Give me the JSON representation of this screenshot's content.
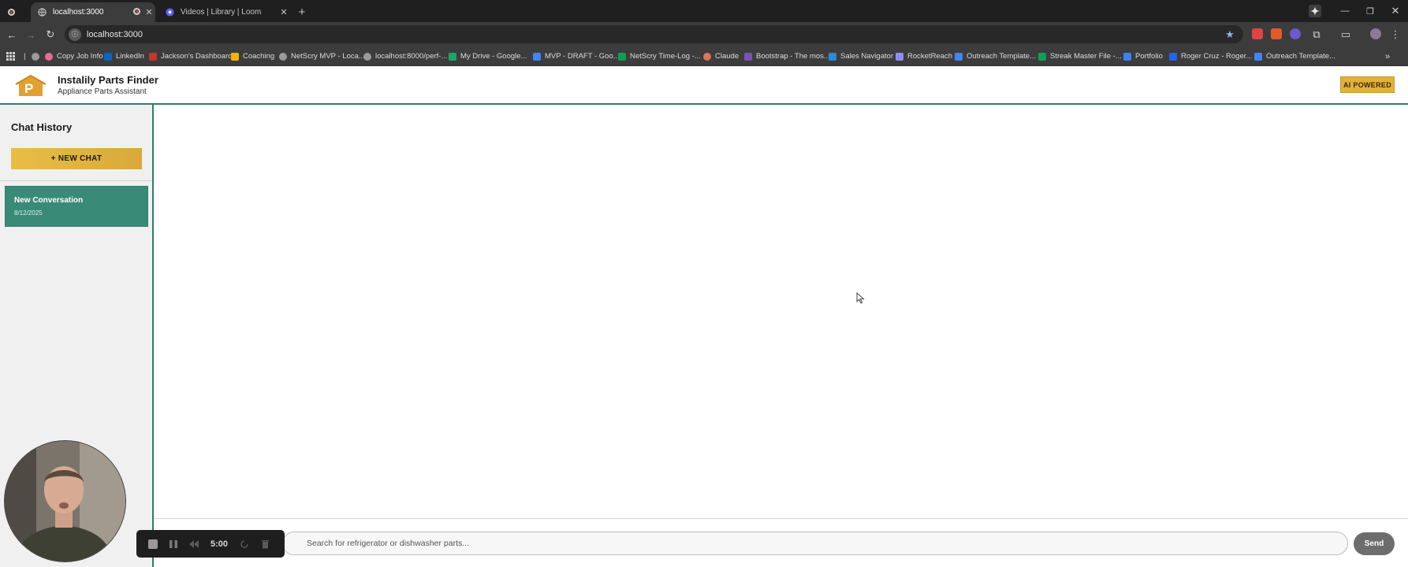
{
  "browser": {
    "tabs": [
      {
        "title": "localhost:3000",
        "active": true
      },
      {
        "title": "Videos | Library | Loom",
        "active": false
      }
    ],
    "new_tab_label": "+",
    "url": "localhost:3000",
    "bookmarks": [
      {
        "label": "Copy Job Info",
        "icon": "pink-dot-icon"
      },
      {
        "label": "LinkedIn",
        "icon": "linkedin-icon"
      },
      {
        "label": "Jackson's Dashboard",
        "icon": "dashboard-icon"
      },
      {
        "label": "Coaching",
        "icon": "drive-icon"
      },
      {
        "label": "NetScry MVP - Loca...",
        "icon": "globe-icon"
      },
      {
        "label": "localhost:8000/perf-...",
        "icon": "globe-icon"
      },
      {
        "label": "My Drive - Google...",
        "icon": "drive-icon"
      },
      {
        "label": "MVP - DRAFT - Goo...",
        "icon": "docs-icon"
      },
      {
        "label": "NetScry Time-Log -...",
        "icon": "sheets-icon"
      },
      {
        "label": "Claude",
        "icon": "claude-icon"
      },
      {
        "label": "Bootstrap - The mos...",
        "icon": "bootstrap-icon"
      },
      {
        "label": "Sales Navigator",
        "icon": "linkedin-icon"
      },
      {
        "label": "RocketReach",
        "icon": "rocket-icon"
      },
      {
        "label": "Outreach Template...",
        "icon": "docs-icon"
      },
      {
        "label": "Streak Master File -...",
        "icon": "sheets-icon"
      },
      {
        "label": "Portfolio",
        "icon": "portfolio-icon"
      },
      {
        "label": "Roger Cruz - Roger...",
        "icon": "x-icon"
      },
      {
        "label": "Outreach Template...",
        "icon": "docs-icon"
      }
    ]
  },
  "app": {
    "title": "Instalily Parts Finder",
    "subtitle": "Appliance Parts Assistant",
    "badge": "AI POWERED",
    "logo_letter": "P"
  },
  "sidebar": {
    "title": "Chat History",
    "new_chat_label": "+ NEW CHAT",
    "conversations": [
      {
        "title": "New Conversation",
        "date": "8/12/2025"
      }
    ]
  },
  "chat": {
    "input_value": "",
    "input_placeholder": "Search for refrigerator or dishwasher parts...",
    "send_label": "Send"
  },
  "recorder": {
    "time": "5:00"
  },
  "colors": {
    "accent_green": "#2e7d6b",
    "accent_gold": "#e2b13c"
  }
}
